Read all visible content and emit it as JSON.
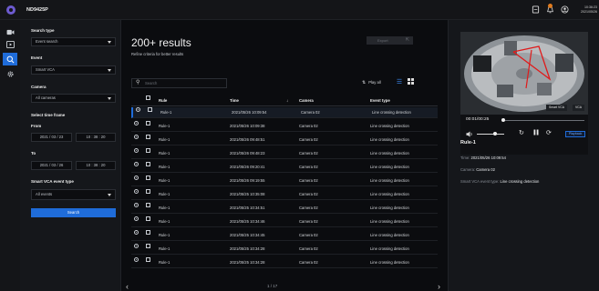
{
  "topbar": {
    "device_name": "ND9425P",
    "clock_time": "10:36:23",
    "clock_date": "2021/05/26",
    "icons": [
      "storage-icon",
      "notification-icon",
      "user-icon"
    ]
  },
  "left_nav": {
    "items": [
      "camera-icon",
      "playback-icon",
      "search-icon",
      "settings-icon"
    ],
    "active": "search-icon"
  },
  "filter": {
    "search_type_label": "Search type",
    "search_type_value": "Event search",
    "event_label": "Event",
    "event_value": "Smart VCA",
    "camera_label": "Camera",
    "camera_value": "All cameras",
    "timeframe_label": "Select time frame",
    "from_label": "From",
    "from_date": "2021 / 03 / 23",
    "from_time": "10 : 38 : 20",
    "to_label": "To",
    "to_date": "2021 / 03 / 26",
    "to_time": "10 : 38 : 20",
    "vca_type_label": "Smart VCA event type",
    "vca_type_value": "All events",
    "search_button": "Search"
  },
  "results": {
    "title": "200+ results",
    "subtitle": "Refine criteria for better results",
    "export_label": "Export",
    "search_placeholder": "Search",
    "play_all_label": "Play all",
    "columns": [
      "Rule",
      "Time",
      "Camera",
      "Event type"
    ],
    "sort_indicator": "↓",
    "rows": [
      {
        "rule": "Rule-1",
        "time": "2021/05/26 10:09:54",
        "camera": "Camera 02",
        "event": "Line crossing detection"
      },
      {
        "rule": "Rule-1",
        "time": "2021/05/26 10:09:38",
        "camera": "Camera 02",
        "event": "Line crossing detection"
      },
      {
        "rule": "Rule-1",
        "time": "2021/05/26 09:48:51",
        "camera": "Camera 02",
        "event": "Line crossing detection"
      },
      {
        "rule": "Rule-1",
        "time": "2021/05/26 09:48:23",
        "camera": "Camera 02",
        "event": "Line crossing detection"
      },
      {
        "rule": "Rule-1",
        "time": "2021/05/26 09:20:41",
        "camera": "Camera 02",
        "event": "Line crossing detection"
      },
      {
        "rule": "Rule-1",
        "time": "2021/05/26 09:19:55",
        "camera": "Camera 02",
        "event": "Line crossing detection"
      },
      {
        "rule": "Rule-1",
        "time": "2021/05/25 10:35:08",
        "camera": "Camera 02",
        "event": "Line crossing detection"
      },
      {
        "rule": "Rule-1",
        "time": "2021/05/25 10:34:51",
        "camera": "Camera 02",
        "event": "Line crossing detection"
      },
      {
        "rule": "Rule-1",
        "time": "2021/05/25 10:34:46",
        "camera": "Camera 02",
        "event": "Line crossing detection"
      },
      {
        "rule": "Rule-1",
        "time": "2021/05/25 10:34:45",
        "camera": "Camera 02",
        "event": "Line crossing detection"
      },
      {
        "rule": "Rule-1",
        "time": "2021/05/25 10:34:28",
        "camera": "Camera 02",
        "event": "Line crossing detection"
      },
      {
        "rule": "Rule-1",
        "time": "2021/05/25 10:34:28",
        "camera": "Camera 02",
        "event": "Line crossing detection"
      }
    ],
    "pager": "1 / 17"
  },
  "preview": {
    "tag_smart_vca": "Smart VCA",
    "tag_vca": "VCA",
    "time": "00:01/00:25",
    "playback_label": "Playback",
    "event_title": "Rule-1",
    "time_label": "Time:",
    "time_value": "2021/05/26 10:09:54",
    "camera_label": "Camera:",
    "camera_value": "Camera 02",
    "vca_type_label": "Smart VCA event type:",
    "vca_type_value": "Line crossing detection"
  },
  "colors": {
    "accent": "#1f6cd9",
    "background": "#0b0c0f",
    "panel": "#15171b",
    "notification": "#e07b1f"
  }
}
